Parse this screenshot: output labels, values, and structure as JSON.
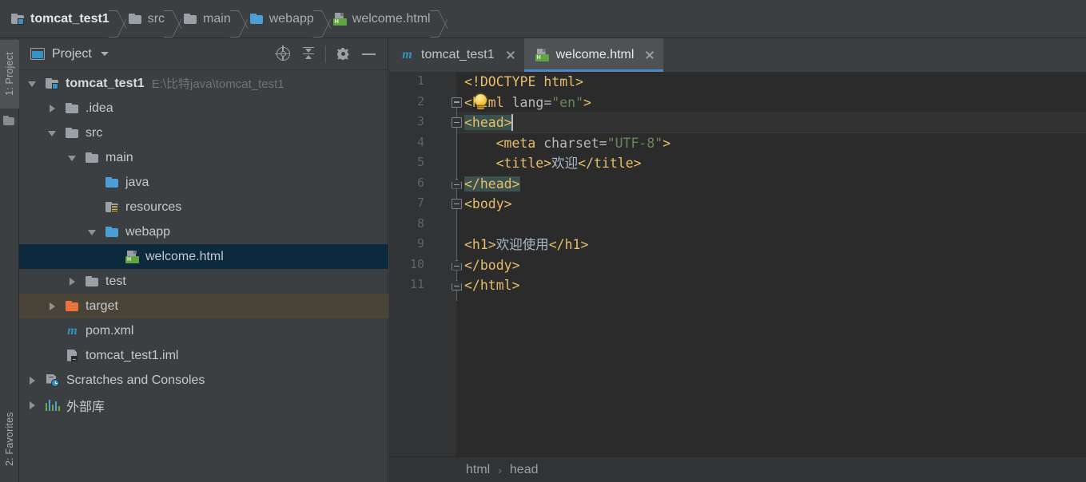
{
  "breadcrumb": {
    "items": [
      {
        "label": "tomcat_test1",
        "icon": "module-icon"
      },
      {
        "label": "src",
        "icon": "folder-icon"
      },
      {
        "label": "main",
        "icon": "folder-icon"
      },
      {
        "label": "webapp",
        "icon": "folder-blue-icon"
      },
      {
        "label": "welcome.html",
        "icon": "html-file-icon"
      }
    ]
  },
  "left_tool_window_bar": {
    "project_tab": "1: Project",
    "favorites_tab": "2: Favorites"
  },
  "project_panel": {
    "title": "Project",
    "toolbar": {
      "select_opened_file": "select-opened-file-icon",
      "collapse_all": "collapse-all-icon",
      "settings": "gear-icon",
      "hide": "minus-icon"
    },
    "tree": [
      {
        "label": "tomcat_test1",
        "path": "E:\\比特java\\tomcat_test1",
        "indent": 0,
        "arrow": "open",
        "icon": "module-icon",
        "bold": true,
        "state": "normal"
      },
      {
        "label": ".idea",
        "path": "",
        "indent": 1,
        "arrow": "closed",
        "icon": "folder-icon",
        "bold": false,
        "state": "normal"
      },
      {
        "label": "src",
        "path": "",
        "indent": 1,
        "arrow": "open",
        "icon": "folder-icon",
        "bold": false,
        "state": "normal"
      },
      {
        "label": "main",
        "path": "",
        "indent": 2,
        "arrow": "open",
        "icon": "folder-icon",
        "bold": false,
        "state": "normal"
      },
      {
        "label": "java",
        "path": "",
        "indent": 3,
        "arrow": "none",
        "icon": "folder-blue-icon",
        "bold": false,
        "state": "normal"
      },
      {
        "label": "resources",
        "path": "",
        "indent": 3,
        "arrow": "none",
        "icon": "resources-icon",
        "bold": false,
        "state": "normal"
      },
      {
        "label": "webapp",
        "path": "",
        "indent": 3,
        "arrow": "open",
        "icon": "folder-blue-icon",
        "bold": false,
        "state": "normal"
      },
      {
        "label": "welcome.html",
        "path": "",
        "indent": 4,
        "arrow": "none",
        "icon": "html-file-icon",
        "bold": false,
        "state": "selected"
      },
      {
        "label": "test",
        "path": "",
        "indent": 2,
        "arrow": "closed",
        "icon": "folder-icon",
        "bold": false,
        "state": "normal"
      },
      {
        "label": "target",
        "path": "",
        "indent": 1,
        "arrow": "closed",
        "icon": "folder-orange-icon",
        "bold": false,
        "state": "hovered"
      },
      {
        "label": "pom.xml",
        "path": "",
        "indent": 1,
        "arrow": "none",
        "icon": "maven-icon",
        "bold": false,
        "state": "normal"
      },
      {
        "label": "tomcat_test1.iml",
        "path": "",
        "indent": 1,
        "arrow": "none",
        "icon": "iml-file-icon",
        "bold": false,
        "state": "normal"
      },
      {
        "label": "Scratches and Consoles",
        "path": "",
        "indent": 0,
        "arrow": "closed",
        "icon": "scratches-icon",
        "bold": false,
        "state": "normal"
      },
      {
        "label": "外部库",
        "path": "",
        "indent": 0,
        "arrow": "closed",
        "icon": "external-libraries-icon",
        "bold": false,
        "state": "normal"
      }
    ]
  },
  "editor": {
    "tabs": [
      {
        "label": "tomcat_test1",
        "icon": "maven-icon",
        "active": false,
        "close": "close-icon"
      },
      {
        "label": "welcome.html",
        "icon": "html-file-icon",
        "active": true,
        "close": "close-icon"
      }
    ],
    "filename": "welcome.html",
    "language": "HTML",
    "caret": {
      "line": 3,
      "column": 7
    },
    "gutter_line_numbers": [
      "1",
      "2",
      "3",
      "4",
      "5",
      "6",
      "7",
      "8",
      "9",
      "10",
      "11"
    ],
    "code_lines": [
      {
        "n": 1,
        "indent": 0,
        "tokens": [
          {
            "t": "<!DOCTYPE html>",
            "c": "tk-doc"
          }
        ]
      },
      {
        "n": 2,
        "indent": 0,
        "tokens": [
          {
            "t": "<html ",
            "c": "tk-tag"
          },
          {
            "t": "lang=",
            "c": "tk-attr"
          },
          {
            "t": "\"en\"",
            "c": "tk-str"
          },
          {
            "t": ">",
            "c": "tk-tag"
          }
        ]
      },
      {
        "n": 3,
        "indent": 0,
        "tokens": [
          {
            "t": "<head>",
            "c": "tk-tag hl-match"
          }
        ]
      },
      {
        "n": 4,
        "indent": 4,
        "tokens": [
          {
            "t": "<meta ",
            "c": "tk-tag"
          },
          {
            "t": "charset=",
            "c": "tk-attr"
          },
          {
            "t": "\"UTF-8\"",
            "c": "tk-str"
          },
          {
            "t": ">",
            "c": "tk-tag"
          }
        ]
      },
      {
        "n": 5,
        "indent": 4,
        "tokens": [
          {
            "t": "<title>",
            "c": "tk-tag"
          },
          {
            "t": "欢迎",
            "c": "tk-txt"
          },
          {
            "t": "</title>",
            "c": "tk-tag"
          }
        ]
      },
      {
        "n": 6,
        "indent": 0,
        "tokens": [
          {
            "t": "</head>",
            "c": "tk-tag hl-match"
          }
        ]
      },
      {
        "n": 7,
        "indent": 0,
        "tokens": [
          {
            "t": "<body>",
            "c": "tk-tag"
          }
        ]
      },
      {
        "n": 8,
        "indent": 0,
        "tokens": []
      },
      {
        "n": 9,
        "indent": 0,
        "tokens": [
          {
            "t": "<h1>",
            "c": "tk-tag"
          },
          {
            "t": "欢迎使用",
            "c": "tk-txt"
          },
          {
            "t": "</h1>",
            "c": "tk-tag"
          }
        ]
      },
      {
        "n": 10,
        "indent": 0,
        "tokens": [
          {
            "t": "</body>",
            "c": "tk-tag"
          }
        ]
      },
      {
        "n": 11,
        "indent": 0,
        "tokens": [
          {
            "t": "</html>",
            "c": "tk-tag"
          }
        ]
      }
    ],
    "intention_bulb": "lightbulb-icon",
    "breadcrumb": [
      "html",
      "head"
    ],
    "breadcrumb_separator": "›"
  },
  "colors": {
    "panel_bg": "#3c3f41",
    "editor_bg": "#2b2b2b",
    "gutter_bg": "#313335",
    "selection_bg": "#0d293e",
    "hover_bg": "#4a4338",
    "accent_blue": "#4a88c7",
    "tag": "#e8bf6a",
    "string": "#6a8759",
    "text": "#a9b7c6",
    "match_highlight": "#3b514d"
  }
}
